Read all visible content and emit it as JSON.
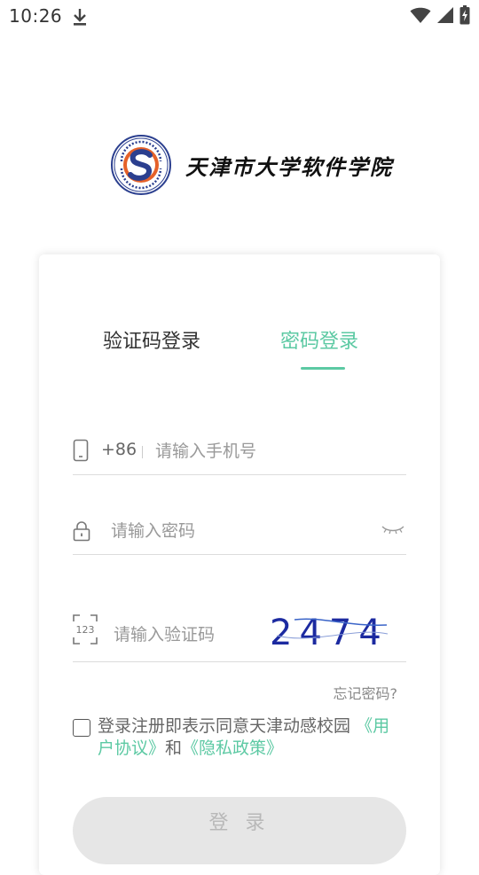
{
  "status_bar": {
    "time": "10:26"
  },
  "school": {
    "name": "天津市大学软件学院"
  },
  "login": {
    "tabs": [
      {
        "label": "验证码登录",
        "active": false
      },
      {
        "label": "密码登录",
        "active": true
      }
    ],
    "phone": {
      "country_code": "+86",
      "placeholder": "请输入手机号"
    },
    "password": {
      "placeholder": "请输入密码"
    },
    "captcha": {
      "placeholder": "请输入验证码",
      "image_text": "2474"
    },
    "forgot_label": "忘记密码?",
    "agreement": {
      "text": "登录注册即表示同意天津动感校园",
      "user_agreement": "《用户协议》",
      "connector": "和",
      "privacy_policy": "《隐私政策》"
    },
    "submit_label": "登 录"
  },
  "colors": {
    "accent": "#5cc9a3",
    "button_disabled_bg": "#e6e6e6",
    "button_disabled_text": "#b8b8b8"
  }
}
